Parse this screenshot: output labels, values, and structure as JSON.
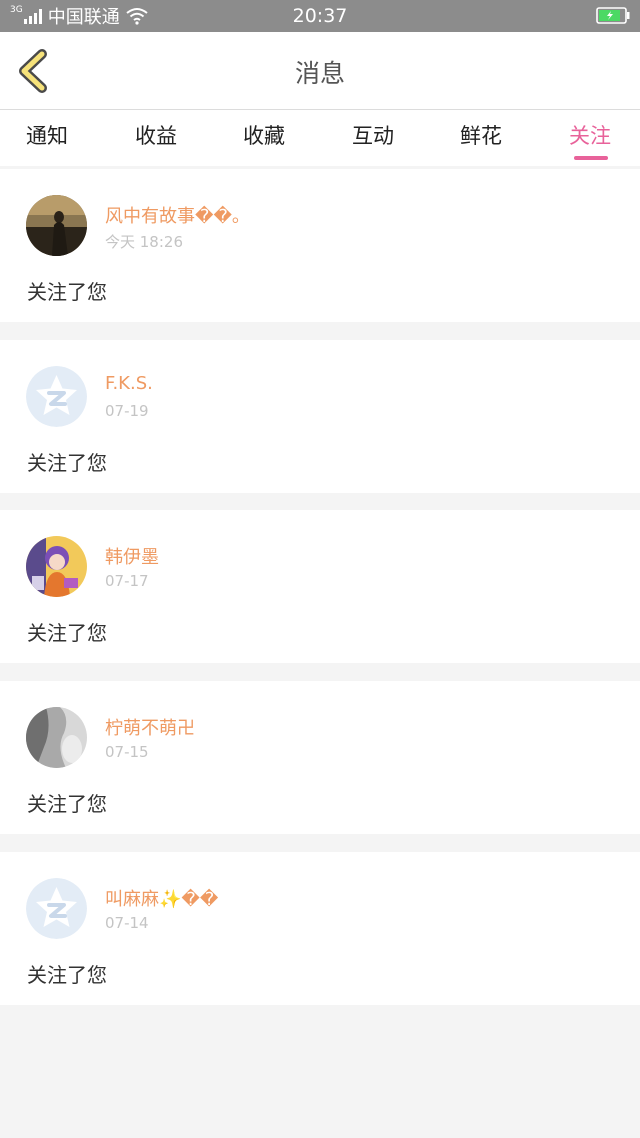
{
  "status_bar": {
    "network": "3G",
    "carrier": "中国联通",
    "time": "20:37",
    "battery_color": "#4cd964"
  },
  "header": {
    "back_icon": "chevron-left-icon",
    "title": "消息"
  },
  "tabs": [
    {
      "label": "通知",
      "active": false
    },
    {
      "label": "收益",
      "active": false
    },
    {
      "label": "收藏",
      "active": false
    },
    {
      "label": "互动",
      "active": false
    },
    {
      "label": "鲜花",
      "active": false
    },
    {
      "label": "关注",
      "active": true
    }
  ],
  "follows": [
    {
      "name": "风中有故事��。",
      "time": "今天 18:26",
      "message": "关注了您",
      "avatar": "silhouette-photo"
    },
    {
      "name": "F.K.S.",
      "time": "07-19",
      "message": "关注了您",
      "avatar": "default-qq-avatar"
    },
    {
      "name": "韩伊墨",
      "time": "07-17",
      "message": "关注了您",
      "avatar": "anime-girl-photo"
    },
    {
      "name": "柠萌不萌卍",
      "time": "07-15",
      "message": "关注了您",
      "avatar": "grayscale-photo"
    },
    {
      "name": "叫麻麻✨��",
      "time": "07-14",
      "message": "关注了您",
      "avatar": "default-qq-avatar"
    }
  ],
  "colors": {
    "accent": "#e8629a",
    "username": "#ef9a62",
    "back_icon": "#f6e27a"
  }
}
